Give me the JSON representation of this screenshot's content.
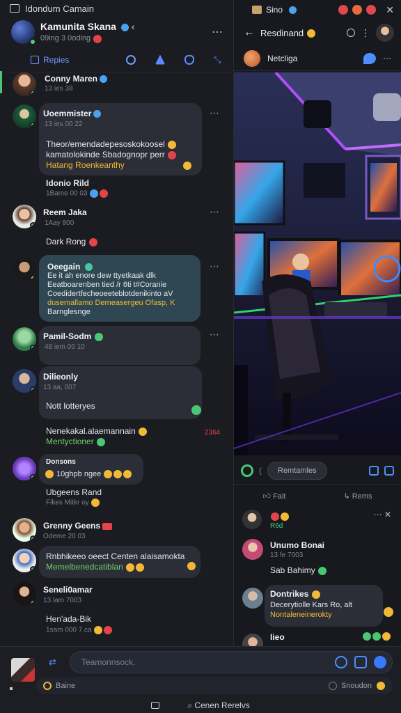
{
  "window": {
    "title": "Idondum Camain"
  },
  "room": {
    "name": "Kamunita Skana",
    "subtitle": "09ing 3 0oding"
  },
  "toolbar": {
    "replies_label": "Repies"
  },
  "messages": [
    {
      "name": "Conny Maren",
      "time": "13 ies 38",
      "text": "",
      "variant": "plain"
    },
    {
      "name": "Uoemmister",
      "time": "13 ies 00 22",
      "lines": [
        "Theor/emendadepesoskokoosel",
        "kamatolokinde Sbadognopr perr",
        "Hatang Roenkeanthy"
      ],
      "variant": "bubble"
    },
    {
      "name": "",
      "time": "",
      "text": "Idonio Rild",
      "sub": "1Bame 00 03",
      "variant": "plain"
    },
    {
      "name": "Reem Jaka",
      "time": "1Aay 800",
      "text": "Dark Rong",
      "variant": "plain"
    },
    {
      "name": "Oeegain",
      "time": "",
      "lines": [
        "Ee it ah enore dew ttyetkaak dlk",
        "Eeatboarenben tied /r 6ti t#Coranie",
        "Coedidertfecheoeeteblotdenikinto aV",
        "dusemallamo Demeasergeu Ofasp, K",
        "Barnglesnge"
      ],
      "variant": "teal"
    },
    {
      "name": "Pamil-Sodm",
      "time": "48 iem 00 10",
      "text": "",
      "variant": "bubble-empty"
    },
    {
      "name": "Dilieonly",
      "time": "13 aa, 007",
      "text": "Nott lotteryes",
      "variant": "bubble"
    },
    {
      "name": "",
      "time": "",
      "lines": [
        "Nenekakal.alaemannain",
        "Mentyctioner"
      ],
      "side": "2364",
      "variant": "plain"
    },
    {
      "name": "Donsons",
      "time": "",
      "text": "10ghpb ngee",
      "variant": "bubble"
    },
    {
      "name": "",
      "time": "",
      "text": "Ubgeens Rand",
      "sub": "Fikes Mitkr oy",
      "variant": "plain"
    },
    {
      "name": "Grenny Geens",
      "time": "Odeme 20 03",
      "text": "",
      "variant": "plain"
    },
    {
      "name": "",
      "time": "",
      "lines": [
        "Rnbhikeeo oeect Centen alaisamokta",
        "Memelbenedcatiblan"
      ],
      "variant": "bubble"
    },
    {
      "name": "Seneli0amar",
      "time": "13 lam 7003",
      "text": "Hen'ada-Bik",
      "sub": "1sam 000 7.ca",
      "variant": "plain"
    }
  ],
  "right": {
    "title": "Sino",
    "header_title": "Resdinand",
    "sub_name": "Netcliga",
    "chip": "Remtamles",
    "react_left": "Fait",
    "react_right": "Rems",
    "comments": [
      {
        "name": "",
        "text": "R6d",
        "variant": "react"
      },
      {
        "name": "Unumo Bonai",
        "time": "13 fe 7003",
        "text": "Sab Bahimy"
      },
      {
        "name": "Dontrikes",
        "lines": [
          "Decerytiolle Kars Ro, alt",
          "Nontaleneinerokty"
        ],
        "variant": "bubble"
      },
      {
        "name": "Iieo",
        "text": ""
      }
    ]
  },
  "composer": {
    "placeholder": "Teamonnsock.",
    "row2_left": "Baine",
    "row2_right": "Snoudon",
    "bottom_left": "",
    "bottom_search": "Cenen Rerelvs"
  },
  "colors": {
    "accent": "#4e8eff",
    "online": "#49c775",
    "bg": "#1a1c22"
  }
}
